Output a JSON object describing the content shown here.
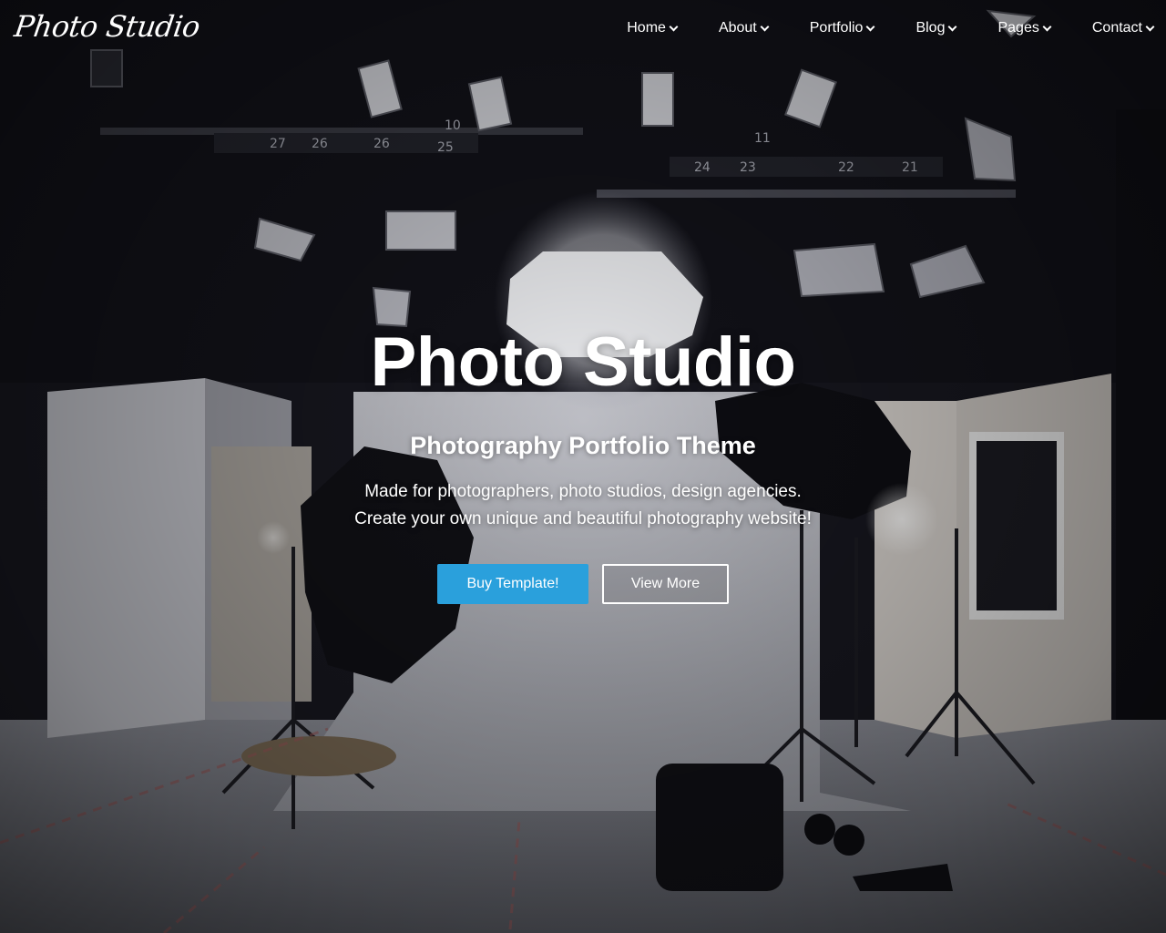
{
  "brand": {
    "logo_text": "Photo Studio"
  },
  "nav": {
    "items": [
      {
        "label": "Home"
      },
      {
        "label": "About"
      },
      {
        "label": "Portfolio"
      },
      {
        "label": "Blog"
      },
      {
        "label": "Pages"
      },
      {
        "label": "Contact"
      }
    ]
  },
  "hero": {
    "title": "Photo Studio",
    "subtitle": "Photography Portfolio Theme",
    "description_line1": "Made for photographers, photo studios, design agencies.",
    "description_line2": "Create your own unique and beautiful photography website!",
    "primary_button": "Buy Template!",
    "secondary_button": "View More"
  },
  "background_labels": [
    "27",
    "26",
    "26",
    "25",
    "10",
    "11",
    "24",
    "23",
    "22",
    "21"
  ],
  "colors": {
    "accent": "#2aa0dc",
    "text": "#ffffff",
    "backdrop": "#15151c"
  },
  "icons": {
    "dropdown": "chevron-down-icon"
  }
}
